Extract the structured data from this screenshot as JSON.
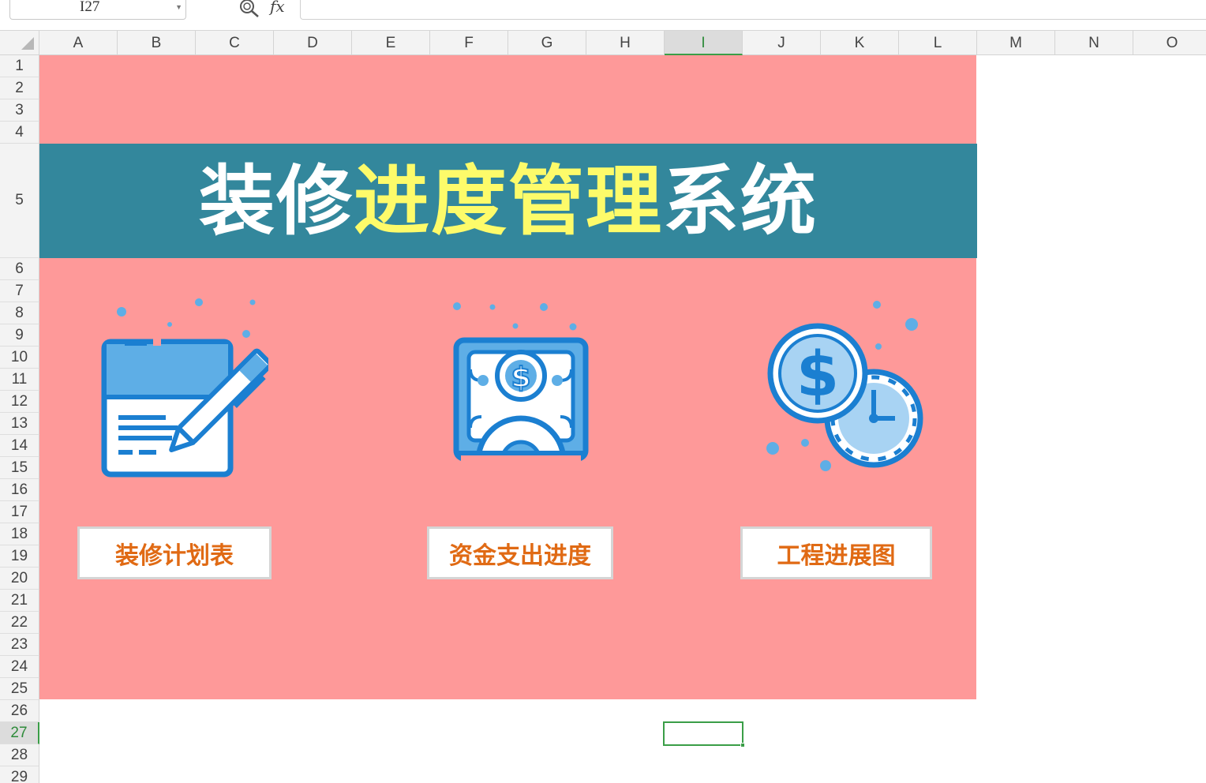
{
  "formula_bar": {
    "name_box": "I27",
    "fx_label": "fx",
    "formula_value": ""
  },
  "columns": [
    "A",
    "B",
    "C",
    "D",
    "E",
    "F",
    "G",
    "H",
    "I",
    "J",
    "K",
    "L",
    "M",
    "N",
    "O"
  ],
  "rows": [
    "1",
    "2",
    "3",
    "4",
    "5",
    "6",
    "7",
    "8",
    "9",
    "10",
    "11",
    "12",
    "13",
    "14",
    "15",
    "16",
    "17",
    "18",
    "19",
    "20",
    "21",
    "22",
    "23",
    "24",
    "25",
    "26",
    "27",
    "28",
    "29"
  ],
  "active_column": "I",
  "active_row": "27",
  "dashboard": {
    "title_part1": "装修",
    "title_part2": "进度管理",
    "title_part3": "系统",
    "buttons": [
      {
        "label": "装修计划表",
        "icon": "plan-document-icon"
      },
      {
        "label": "资金支出进度",
        "icon": "money-gear-icon"
      },
      {
        "label": "工程进展图",
        "icon": "coin-clock-icon"
      }
    ]
  },
  "colors": {
    "background_pink": "#fe9999",
    "title_band": "#33879c",
    "title_white": "#ffffff",
    "title_yellow": "#fdfb6a",
    "button_text": "#e06a14",
    "selection_green": "#3a9e47",
    "icon_blue_dark": "#1b7fd1",
    "icon_blue_light": "#5eaee6"
  }
}
